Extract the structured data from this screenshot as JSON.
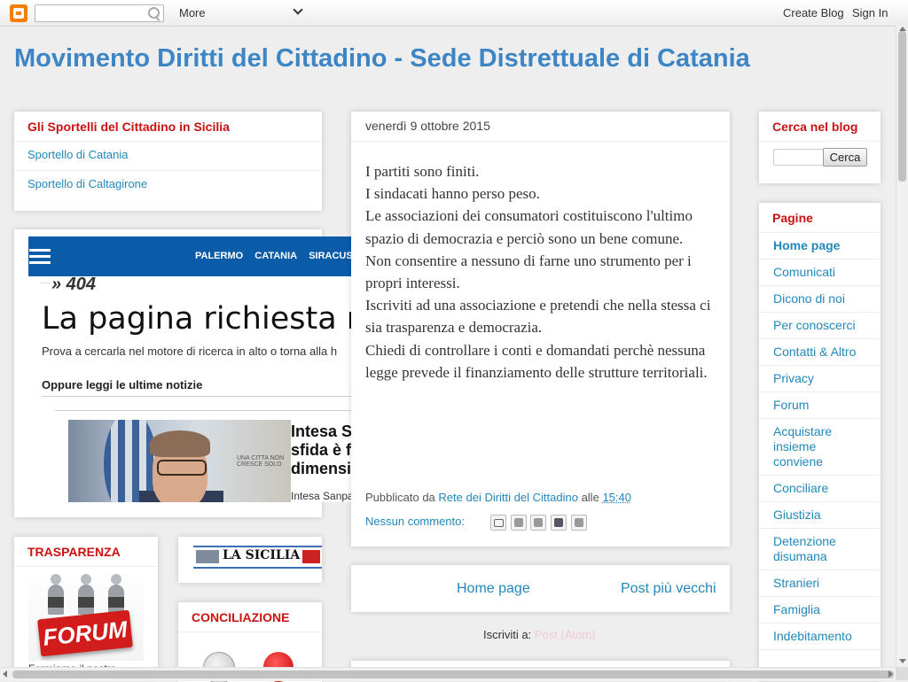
{
  "navbar": {
    "search_placeholder": "",
    "more_label": "More",
    "create_blog": "Create Blog",
    "sign_in": "Sign In"
  },
  "blog": {
    "title": "Movimento Diritti del Cittadino - Sede Distrettuale di Catania"
  },
  "sportelli": {
    "title": "Gli Sportelli del Cittadino in Sicilia",
    "links": [
      "Sportello di Catania",
      "Sportello di Caltagirone"
    ]
  },
  "embed": {
    "nav": [
      "PALERMO",
      "CATANIA",
      "SIRACUS"
    ],
    "code": "» 404",
    "heading": "La pagina richiesta non",
    "text": "Prova a cercarla nel motore di ricerca in alto o torna alla h",
    "subheading": "Oppure leggi le ultime notizie",
    "photo_sign": "UNA CITTA NON CRESCE SOLO",
    "headline": "Intesa Sa sfida è fa dimensio",
    "caption": "Intesa Sanpa"
  },
  "trasparenza": {
    "title": "TRASPARENZA",
    "image_text": "FORUM",
    "text": "Formiamo il nostro"
  },
  "lasicilia": {
    "logo_text": "LA SICILIA"
  },
  "conciliazione": {
    "title": "CONCILIAZIONE"
  },
  "post": {
    "date": "venerdì 9 ottobre 2015",
    "lines": [
      "I partiti sono finiti.",
      "I sindacati hanno perso peso.",
      "Le associazioni dei consumatori costituiscono l'ultimo spazio di democrazia e perciò sono un bene comune.",
      "Non consentire a nessuno di farne uno strumento per i propri interessi.",
      "Iscriviti  ad una associazione e pretendi che nella stessa ci sia trasparenza e democrazia.",
      "Chiedi  di controllare i conti e domandati  perchè nessuna legge prevede il finanziamento delle strutture territoriali."
    ],
    "published_by": "Pubblicato da",
    "author": "Rete dei Diritti del Cittadino",
    "at": "alle",
    "time": "15:40",
    "comments": "Nessun commento:"
  },
  "pager": {
    "home": "Home page",
    "older": "Post più vecchi"
  },
  "subscribe": {
    "label": "Iscriviti a:",
    "feed": "Post (Atom)"
  },
  "search_widget": {
    "title": "Cerca nel blog",
    "button": "Cerca"
  },
  "pages": {
    "title": "Pagine",
    "items": [
      "Home page",
      "Comunicati",
      "Dicono di noi",
      "Per conoscerci",
      "Contatti & Altro",
      "Privacy",
      "Forum",
      "Acquistare insieme conviene",
      "Conciliare",
      "Giustizia",
      "Detenzione disumana",
      "Stranieri",
      "Famiglia",
      "Indebitamento"
    ]
  },
  "colors": {
    "title_blue": "#3d86c6",
    "widget_title_red": "#cc1111",
    "link_blue": "#2288bb",
    "embed_bar_blue": "#0a5ca9"
  }
}
